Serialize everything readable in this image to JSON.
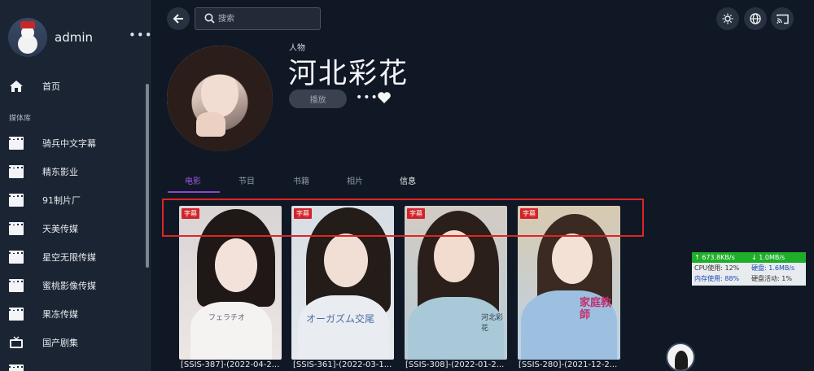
{
  "sidebar": {
    "username": "admin",
    "more_glyph": "•••",
    "home_label": "首页",
    "section_label": "媒体库",
    "items": [
      {
        "label": "骑兵中文字幕",
        "icon": "film-icon"
      },
      {
        "label": "精东影业",
        "icon": "film-icon"
      },
      {
        "label": "91制片厂",
        "icon": "film-icon"
      },
      {
        "label": "天美传媒",
        "icon": "film-icon"
      },
      {
        "label": "星空无限传媒",
        "icon": "film-icon"
      },
      {
        "label": "蜜桃影像传媒",
        "icon": "film-icon"
      },
      {
        "label": "果冻传媒",
        "icon": "film-icon"
      },
      {
        "label": "国产剧集",
        "icon": "tv-icon"
      }
    ]
  },
  "header": {
    "search_placeholder": "搜索"
  },
  "person": {
    "role": "人物",
    "name": "河北彩花",
    "play_label": "播放",
    "more_glyph": "•••"
  },
  "tabs": [
    {
      "label": "电影",
      "active": true
    },
    {
      "label": "节目",
      "active": false
    },
    {
      "label": "书籍",
      "active": false
    },
    {
      "label": "相片",
      "active": false
    },
    {
      "label": "信息",
      "active": false
    }
  ],
  "cards": [
    {
      "badge": "字幕",
      "caption": "[SSIS-387]-(2022-04-2...",
      "deco": "フェラチオ"
    },
    {
      "badge": "字幕",
      "caption": "[SSIS-361]-(2022-03-1...",
      "deco": "オーガズム交尾"
    },
    {
      "badge": "字幕",
      "caption": "[SSIS-308]-(2022-01-2...",
      "deco": "河北彩花"
    },
    {
      "badge": "字幕",
      "caption": "[SSIS-280]-(2021-12-2...",
      "deco": "家庭教師"
    }
  ],
  "monitor": {
    "upload": "↑ 673.8KB/s",
    "download": "↓ 1.0MB/s",
    "cpu": "CPU使用: 12%",
    "disk": "硬盘: 1.6MB/s",
    "mem": "内存使用: 88%",
    "disk_activity": "硬盘活动: 1%"
  },
  "colors": {
    "accent": "#8e44c9",
    "badge": "#d2232a",
    "highlight": "#e02424",
    "background": "#101826",
    "sidebar": "#1b2433"
  }
}
